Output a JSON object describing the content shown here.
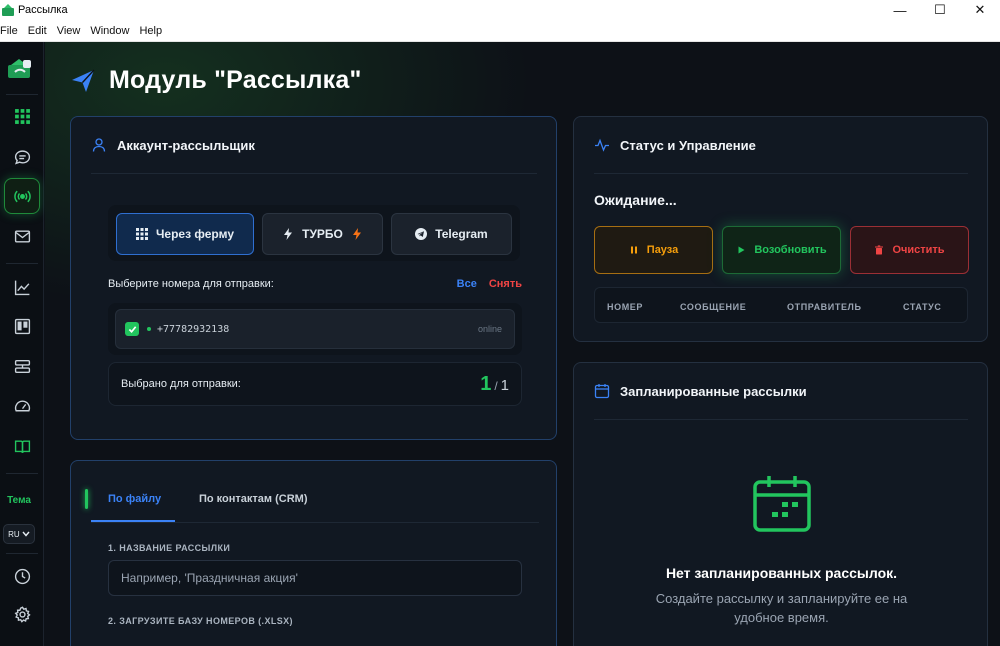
{
  "window": {
    "title": "Рассылка",
    "controls": {
      "minimize": "—",
      "maximize": "☐",
      "close": "✕"
    }
  },
  "menu": [
    "File",
    "Edit",
    "View",
    "Window",
    "Help"
  ],
  "sidebar": {
    "theme_label": "Тема",
    "language": "RU",
    "items": [
      {
        "icon": "grid-icon"
      },
      {
        "icon": "chat-icon"
      },
      {
        "icon": "broadcast-icon",
        "active": true
      },
      {
        "icon": "mail-icon"
      },
      {
        "icon": "chart-icon"
      },
      {
        "icon": "kanban-icon"
      },
      {
        "icon": "server-icon"
      },
      {
        "icon": "gauge-icon"
      },
      {
        "icon": "book-icon"
      }
    ],
    "bottom_items": [
      {
        "icon": "clock-icon"
      },
      {
        "icon": "gear-icon"
      }
    ]
  },
  "page": {
    "title": "Модуль \"Рассылка\""
  },
  "account": {
    "title": "Аккаунт-рассыльщик",
    "modes": [
      "Через ферму",
      "ТУРБО",
      "Telegram"
    ],
    "active_mode": "Через ферму",
    "numbers_label": "Выберите номера для отправки:",
    "select_all": "Все",
    "clear_all": "Снять",
    "numbers": [
      {
        "phone": "+77782932138",
        "status": "online",
        "checked": true
      }
    ],
    "selected_label": "Выбрано для отправки:",
    "selected_count": "1",
    "selected_separator": "/",
    "total_count": "1"
  },
  "form": {
    "tabs": [
      "По файлу",
      "По контактам (CRM)"
    ],
    "active_tab": "По файлу",
    "name_label": "1. НАЗВАНИЕ РАССЫЛКИ",
    "name_placeholder": "Например, 'Праздничная акция'",
    "upload_label": "2. ЗАГРУЗИТЕ БАЗУ НОМЕРОВ (.XLSX)"
  },
  "status": {
    "title": "Статус и Управление",
    "state": "Ожидание...",
    "buttons": {
      "pause": "Пауза",
      "resume": "Возобновить",
      "clear": "Очистить"
    },
    "columns": [
      "НОМЕР",
      "СООБЩЕНИЕ",
      "ОТПРАВИТЕЛЬ",
      "СТАТУС"
    ]
  },
  "scheduled": {
    "title": "Запланированные рассылки",
    "empty_title": "Нет запланированных рассылок.",
    "empty_desc": "Создайте рассылку и запланируйте ее на удобное время."
  },
  "colors": {
    "accent_green": "#22c55e",
    "accent_blue": "#3b82f6",
    "warning": "#f59e0b",
    "danger": "#ef4444",
    "background": "#0d1117"
  }
}
